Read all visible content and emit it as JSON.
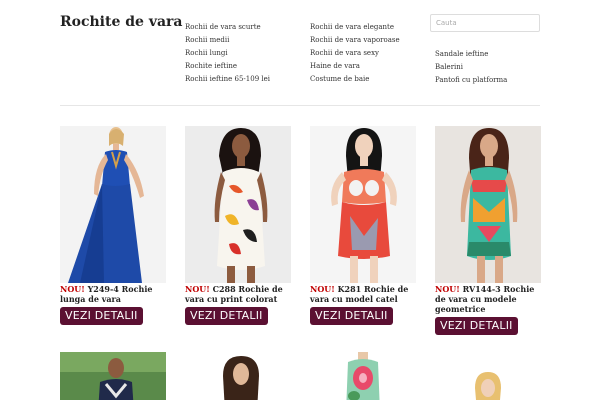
{
  "site": {
    "title": "Rochite de vara"
  },
  "nav": {
    "col1": [
      "Rochii de vara scurte",
      "Rochii medii",
      "Rochii lungi",
      "Rochite ieftine",
      "Rochii ieftine 65-109 lei"
    ],
    "col2": [
      "Rochii de vara elegante",
      "Rochii de vara vaporoase",
      "Rochii de vara sexy",
      "Haine de vara",
      "Costume de baie"
    ],
    "col3": [
      "Sandale ieftine",
      "Balerini",
      "Pantofi cu platforma"
    ]
  },
  "search": {
    "placeholder": "Cauta"
  },
  "products": [
    {
      "badge": "NOU!",
      "title": "Y249-4 Rochie lunga de vara",
      "button": "VEZI DETALII"
    },
    {
      "badge": "NOU!",
      "title": "C288 Rochie de vara cu print colorat",
      "button": "VEZI DETALII"
    },
    {
      "badge": "NOU!",
      "title": "K281 Rochie de vara cu model catel",
      "button": "VEZI DETALII"
    },
    {
      "badge": "NOU!",
      "title": "RV144-3 Rochie de vara cu modele geometrice",
      "button": "VEZI DETALII"
    }
  ],
  "colors": {
    "button_bg": "#5b1032",
    "badge": "#c00000"
  }
}
